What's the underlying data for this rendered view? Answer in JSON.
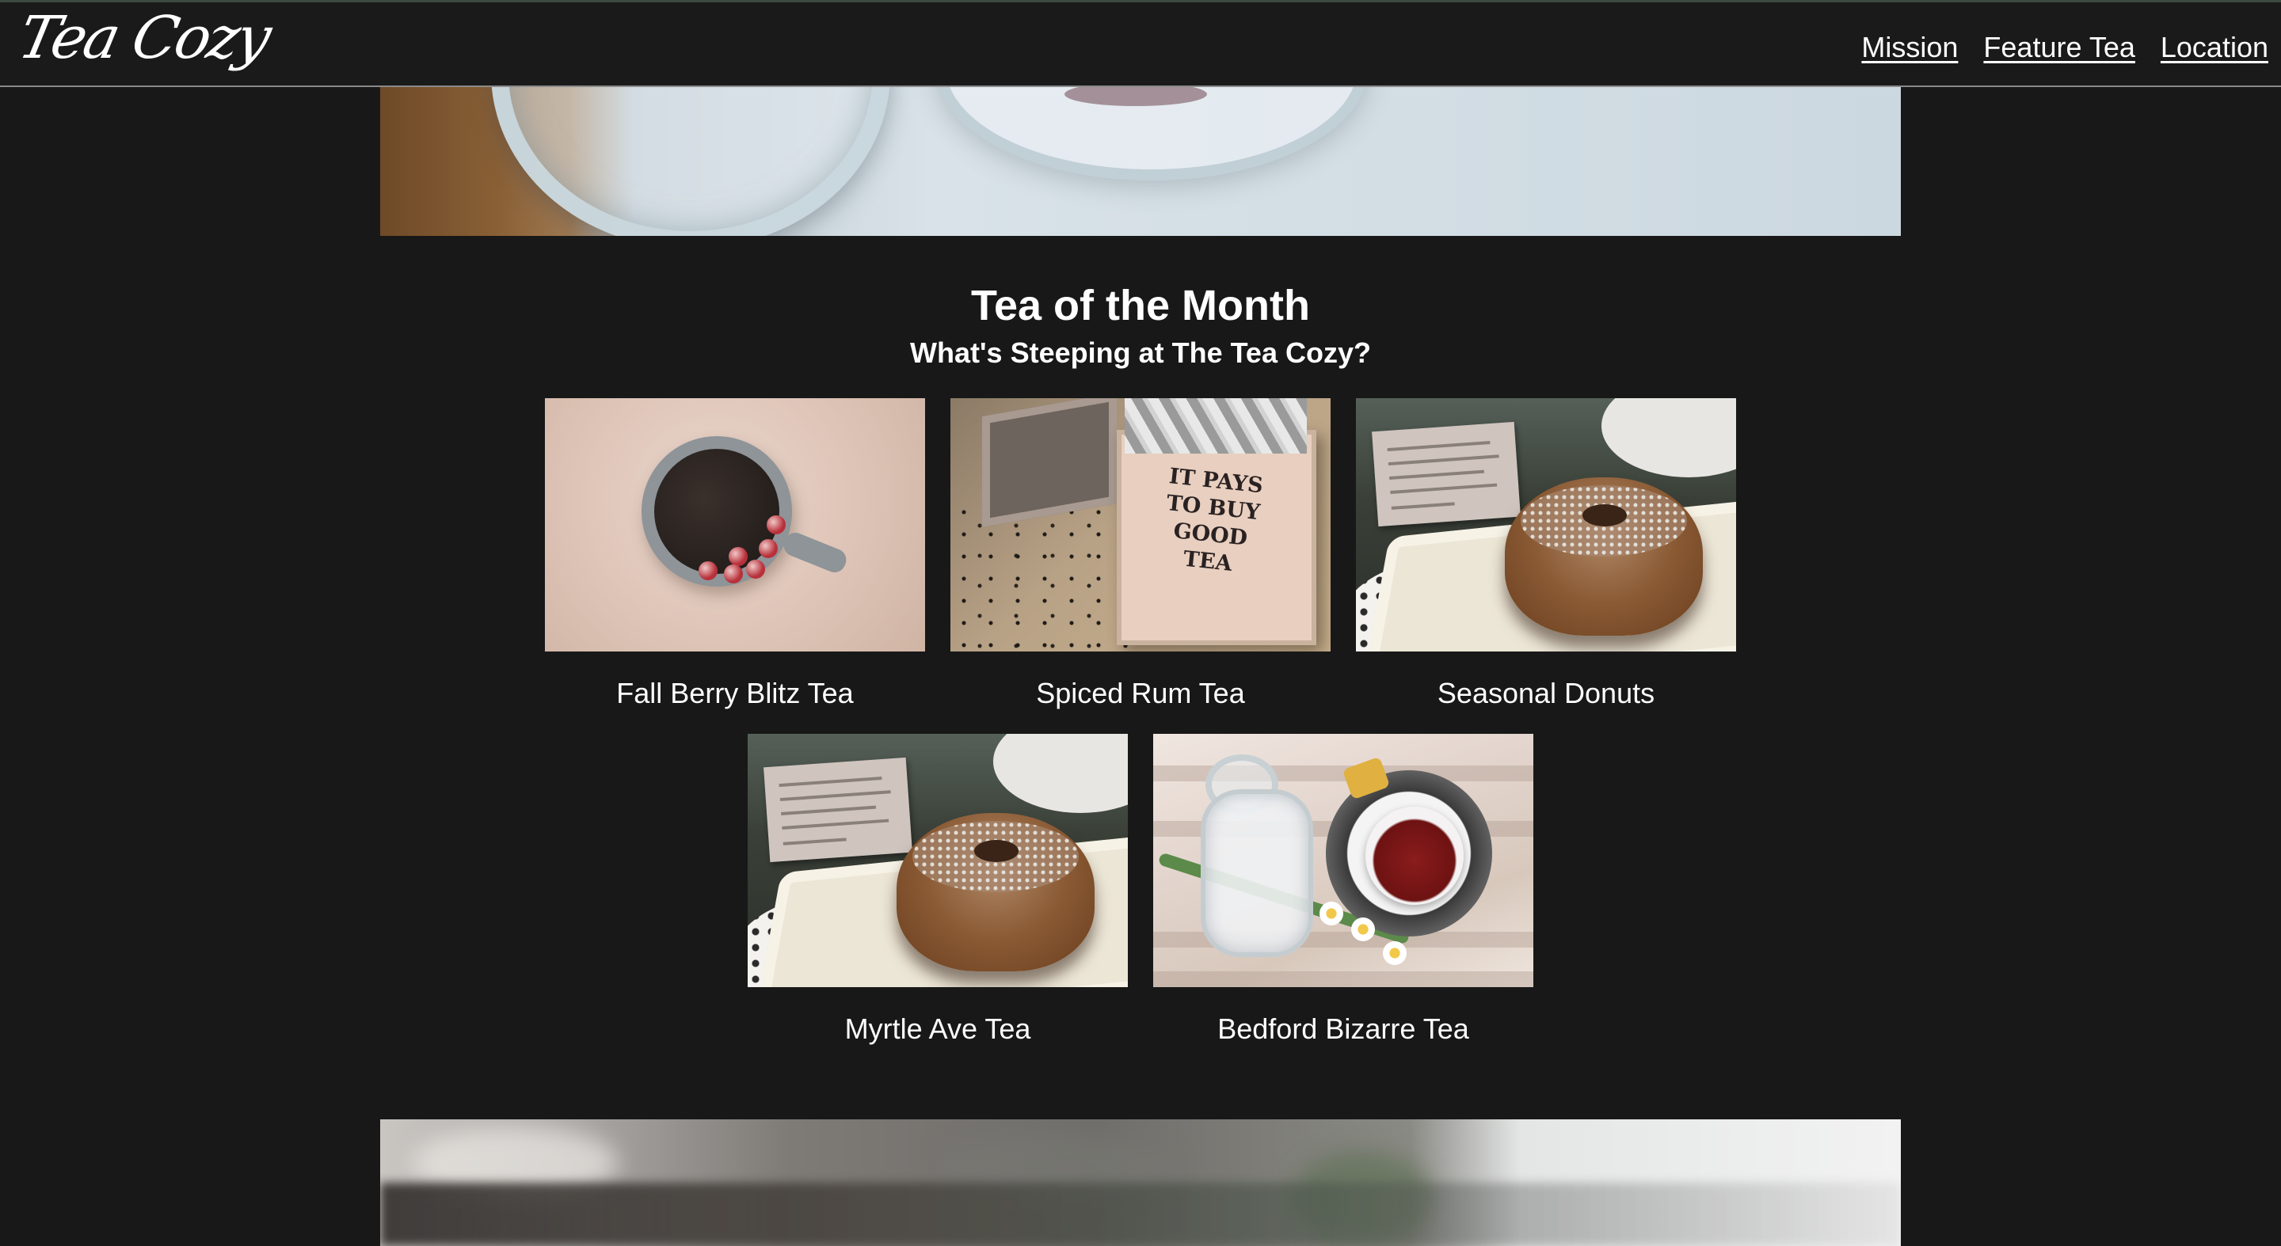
{
  "header": {
    "logo_text": "Tea Cozy",
    "nav": [
      {
        "label": "Mission"
      },
      {
        "label": "Feature Tea"
      },
      {
        "label": "Location"
      }
    ]
  },
  "section": {
    "title": "Tea of the Month",
    "subtitle": "What's Steeping at The Tea Cozy?"
  },
  "teas": [
    {
      "name": "Fall Berry Blitz Tea",
      "image": "berry-tea-photo"
    },
    {
      "name": "Spiced Rum Tea",
      "image": "spiced-rum-tea-box-photo",
      "box_text": "IT PAYS\nTO BUY\nGOOD\nTEA"
    },
    {
      "name": "Seasonal Donuts",
      "image": "donut-photo"
    },
    {
      "name": "Myrtle Ave Tea",
      "image": "donut-photo"
    },
    {
      "name": "Bedford Bizarre Tea",
      "image": "red-tea-cup-photo"
    }
  ],
  "colors": {
    "background": "#181818",
    "text": "#ffffff",
    "header_border": "#8a8a8a"
  }
}
